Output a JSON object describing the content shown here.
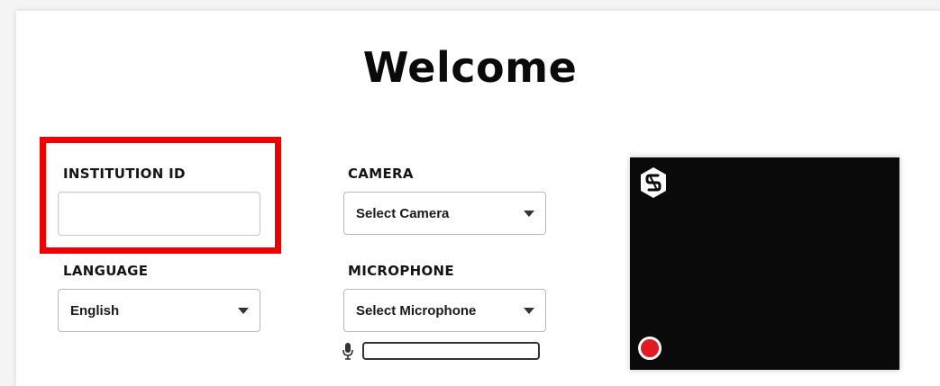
{
  "page": {
    "title": "Welcome"
  },
  "form": {
    "institution_id": {
      "label": "INSTITUTION ID",
      "value": ""
    },
    "language": {
      "label": "LANGUAGE",
      "selected": "English"
    },
    "camera": {
      "label": "CAMERA",
      "selected": "Select Camera"
    },
    "microphone": {
      "label": "MICROPHONE",
      "selected": "Select Microphone",
      "level": 0
    }
  },
  "preview": {
    "logo_icon": "brand-logo-icon",
    "record_icon": "record-dot-icon"
  },
  "colors": {
    "highlight": "#ee0000",
    "record": "#e21a24",
    "video_bg": "#0a0a0a"
  }
}
